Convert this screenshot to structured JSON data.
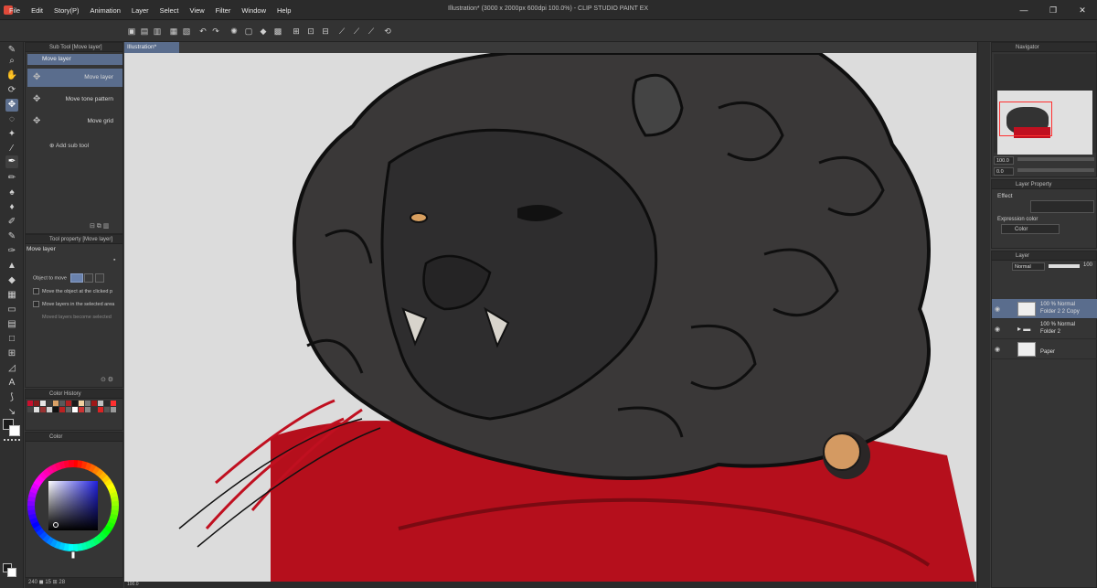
{
  "app": {
    "title": "Illustration* (3000 x 2000px 600dpi 100.0%) - CLIP STUDIO PAINT EX",
    "window_buttons": [
      "—",
      "❐",
      "✕"
    ]
  },
  "menu": [
    "File",
    "Edit",
    "Story(P)",
    "Animation",
    "Layer",
    "Select",
    "View",
    "Filter",
    "Window",
    "Help"
  ],
  "toolbar": {
    "icons": [
      "new-icon",
      "open-icon",
      "save-icon",
      "undo-icon",
      "redo-icon",
      "transform-icon",
      "fill-icon",
      "select-icon",
      "grid-icon",
      "ruler-icon",
      "snap-icon",
      "refresh-icon"
    ]
  },
  "tools": [
    "pen-icon",
    "zoom-icon",
    "hand-icon",
    "rotate-icon",
    "move-icon",
    "lasso-icon",
    "magic-wand-icon",
    "eyedropper-icon",
    "pen-tool-icon",
    "pencil-icon",
    "brush-icon",
    "airbrush-icon",
    "decoration-icon",
    "eraser-icon",
    "blend-icon",
    "fill-tool-icon",
    "gradient-icon",
    "figure-icon",
    "frame-icon",
    "ruler-tool-icon",
    "text-icon",
    "balloon-icon",
    "correction-icon"
  ],
  "subtool": {
    "title": "Sub Tool [Move layer]",
    "group": "Move layer",
    "items": [
      "Move layer",
      "Move tone pattern",
      "Move grid"
    ],
    "add_label": "Add sub tool"
  },
  "toolprop": {
    "title": "Tool property [Move layer]",
    "name": "Move layer",
    "object_label": "Object to move",
    "options": [
      "Move the object at the clicked p",
      "Move layers in the selected area",
      "Moved layers become selected"
    ]
  },
  "colorhist": {
    "title": "Color History",
    "swatches": [
      "#c8102e",
      "#8a1a1a",
      "#e6e6e6",
      "#3a3a3a",
      "#d9a066",
      "#5a5a5a",
      "#b22222",
      "#1a1a1a",
      "#f0d0a0",
      "#777777",
      "#a01818",
      "#c0c0c0",
      "#2a2a2a",
      "#ff3030",
      "#444444",
      "#e0e0e0",
      "#993333",
      "#d0d0d0",
      "#111111",
      "#bb2222",
      "#666666",
      "#ffffff",
      "#cc3333",
      "#888888",
      "#333333",
      "#dd2222",
      "#555555",
      "#999999"
    ]
  },
  "color": {
    "title": "Color",
    "main": "#1a1a1a",
    "sub": "#ffffff"
  },
  "status_left": "240 ◼ 15 ⊞ 28",
  "canvas": {
    "tab": "Illustration*",
    "zoom": "100.0",
    "status": "100.0"
  },
  "navigator": {
    "title": "Navigator",
    "zoom": "100.0",
    "angle": "0.0"
  },
  "layerprop": {
    "title": "Layer Property",
    "effect_label": "Effect",
    "expression_label": "Expression color",
    "expression_value": "Color"
  },
  "layer": {
    "title": "Layer",
    "blend": "Normal",
    "opacity": "100",
    "rows": [
      {
        "line1": "100 % Normal",
        "line2": "Folder 2 2 Copy"
      },
      {
        "line1": "100 % Normal",
        "line2": "Folder 2"
      },
      {
        "line1": "",
        "line2": "Paper"
      }
    ]
  }
}
